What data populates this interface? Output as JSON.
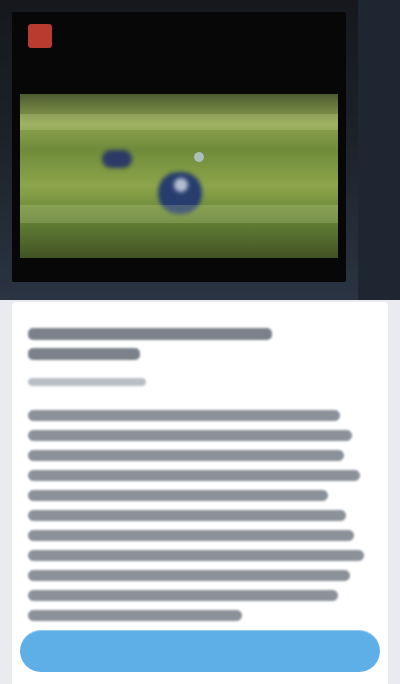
{
  "screen": {
    "theme": "dark-video-top-light-content",
    "accent": "#5eafe8",
    "icons": {
      "channel": "channel-logo-icon"
    }
  },
  "video": {
    "state": "playing",
    "scene": "",
    "overlay_text": ""
  },
  "article": {
    "title": "",
    "meta": "",
    "body": ""
  },
  "cta": {
    "label": ""
  }
}
